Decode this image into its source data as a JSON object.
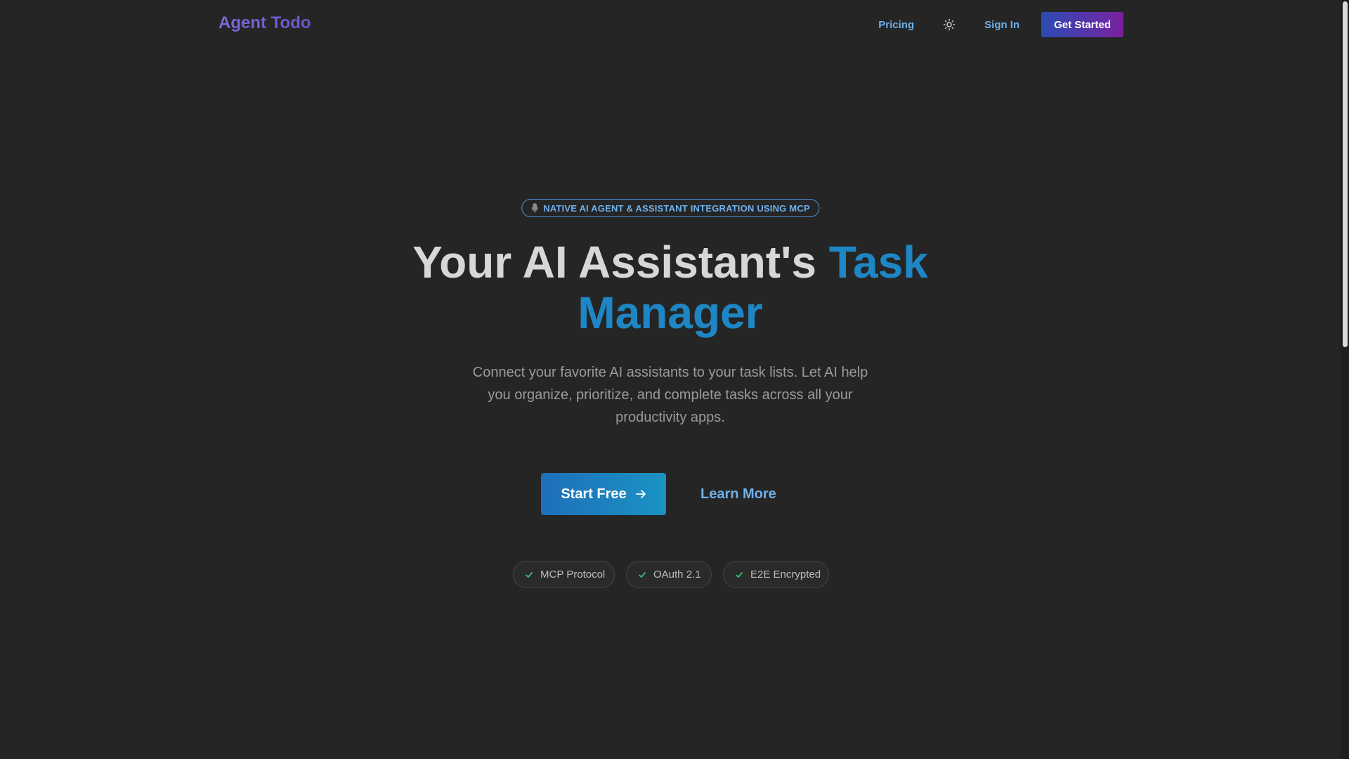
{
  "header": {
    "logo": "Agent Todo",
    "nav": {
      "pricing": "Pricing",
      "theme_icon": "sun-icon",
      "sign_in": "Sign In",
      "get_started": "Get Started"
    }
  },
  "hero": {
    "badge_icon": "microphone-icon",
    "badge": "NATIVE AI AGENT & ASSISTANT INTEGRATION USING MCP",
    "title_main": "Your AI Assistant's ",
    "title_accent": "Task Manager",
    "subtitle": "Connect your favorite AI assistants to your task lists. Let AI help you organize, prioritize, and complete tasks across all your productivity apps.",
    "primary_cta": "Start Free",
    "secondary_cta": "Learn More",
    "features": [
      {
        "label": "MCP Protocol",
        "icon": "check-icon"
      },
      {
        "label": "OAuth 2.1",
        "icon": "check-icon"
      },
      {
        "label": "E2E Encrypted",
        "icon": "check-icon"
      }
    ]
  },
  "colors": {
    "background": "#252525",
    "link": "#6fb0ea",
    "accent_blue": "#1e86c4",
    "check_green": "#3fb970"
  }
}
